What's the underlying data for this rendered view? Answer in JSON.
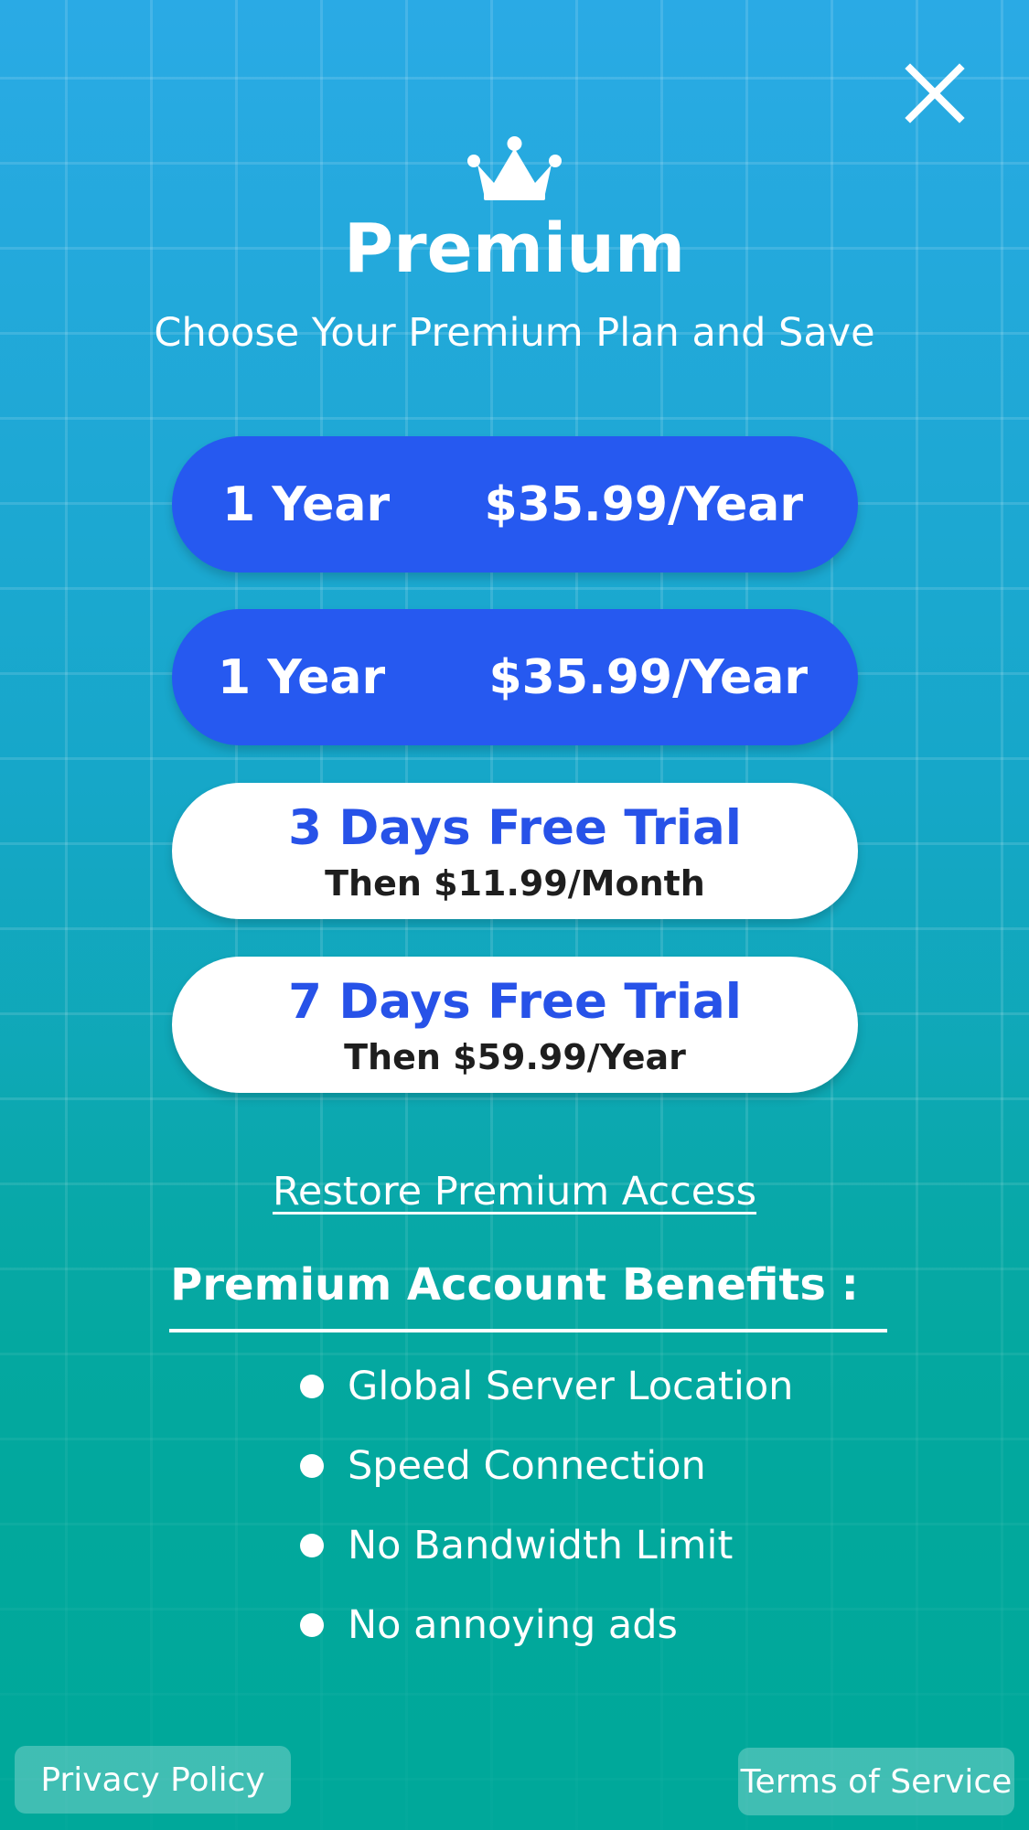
{
  "header": {
    "close_icon": "close-icon",
    "crown_icon": "crown-icon",
    "title": "Premium",
    "subtitle": "Choose Your Premium Plan and Save"
  },
  "plans": [
    {
      "label": "1 Year",
      "price": "$35.99/Year",
      "style": "blue"
    },
    {
      "label": "1 Year",
      "price": "$35.99/Year",
      "style": "blue"
    },
    {
      "title": "3 Days Free Trial",
      "subtitle": "Then $11.99/Month",
      "style": "white"
    },
    {
      "title": "7 Days Free Trial",
      "subtitle": "Then $59.99/Year",
      "style": "white"
    }
  ],
  "restore_link": "Restore Premium Access",
  "benefits": {
    "title": "Premium Account Benefits :",
    "items": [
      "Global Server Location",
      "Speed Connection",
      "No Bandwidth Limit",
      "No annoying ads"
    ]
  },
  "footer": {
    "privacy": "Privacy Policy",
    "terms": "Terms of Service"
  },
  "colors": {
    "background_top": "#2aaae5",
    "background_bottom": "#00a89a",
    "plan_blue": "#2659f0",
    "trial_title": "#2752e8",
    "text_white": "#ffffff"
  }
}
